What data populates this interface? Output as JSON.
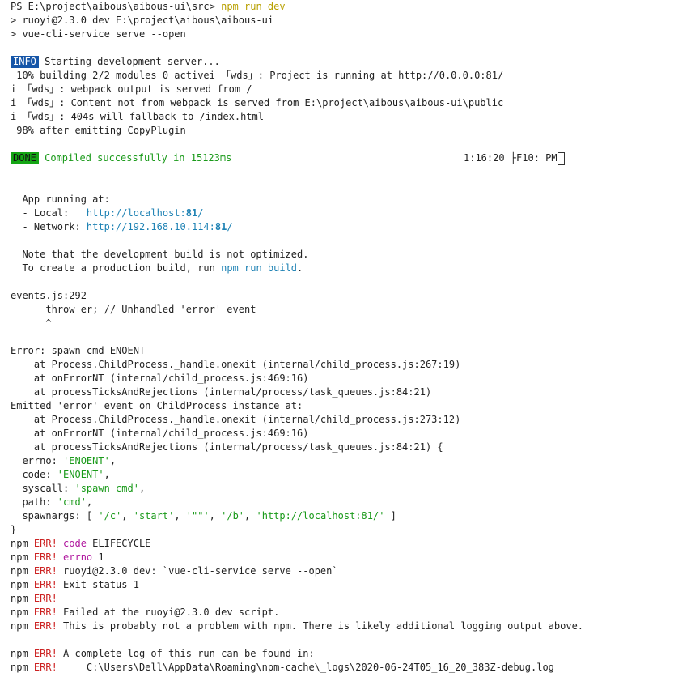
{
  "terminal": {
    "l1": {
      "prompt": "PS E:\\project\\aibous\\aibous-ui\\src> ",
      "cmd": "npm run dev"
    },
    "l2": "> ruoyi@2.3.0 dev E:\\project\\aibous\\aibous-ui",
    "l3": "> vue-cli-service serve --open",
    "info_badge": "INFO",
    "info_text": " Starting development server...",
    "building": " 10% building 2/2 modules 0 activei 「wds」: Project is running at http://0.0.0.0:81/",
    "wds1": "i 「wds」: webpack output is served from /",
    "wds2": "i 「wds」: Content not from webpack is served from E:\\project\\aibous\\aibous-ui\\public",
    "wds3": "i 「wds」: 404s will fallback to /index.html",
    "emitting": " 98% after emitting CopyPlugin",
    "done_badge": "DONE",
    "done_text": " Compiled successfully in 15123ms",
    "done_time": "1:16:20 ├F10: PM",
    "app_running": "  App running at:",
    "local_label": "  - Local:   ",
    "local_url_a": "http://localhost:",
    "local_url_b": "81",
    "local_url_c": "/",
    "network_label": "  - Network: ",
    "network_url_a": "http://192.168.10.114:",
    "network_url_b": "81",
    "network_url_c": "/",
    "note1": "  Note that the development build is not optimized.",
    "note2_a": "  To create a production build, run ",
    "note2_b": "npm run build",
    "note2_c": ".",
    "events": "events.js:292",
    "throw": "      throw er; // Unhandled 'error' event",
    "caret": "      ^",
    "err1": "Error: spawn cmd ENOENT",
    "err2": "    at Process.ChildProcess._handle.onexit (internal/child_process.js:267:19)",
    "err3": "    at onErrorNT (internal/child_process.js:469:16)",
    "err4": "    at processTicksAndRejections (internal/process/task_queues.js:84:21)",
    "emitted": "Emitted 'error' event on ChildProcess instance at:",
    "em2": "    at Process.ChildProcess._handle.onexit (internal/child_process.js:273:12)",
    "em3": "    at onErrorNT (internal/child_process.js:469:16)",
    "em4": "    at processTicksAndRejections (internal/process/task_queues.js:84:21) {",
    "errno_k": "  errno: ",
    "errno_v": "'ENOENT'",
    "comma": ",",
    "code_k": "  code: ",
    "code_v": "'ENOENT'",
    "syscall_k": "  syscall: ",
    "syscall_v": "'spawn cmd'",
    "path_k": "  path: ",
    "path_v": "'cmd'",
    "spawn_k": "  spawnargs: [ ",
    "spawn_v1": "'/c'",
    "spawn_v2": "'start'",
    "spawn_v3": "'\"\"'",
    "spawn_v4": "'/b'",
    "spawn_v5": "'http://localhost:81/'",
    "sep": ", ",
    "spawn_end": " ]",
    "close": "}",
    "npm": "npm ",
    "err": "ERR!",
    "n1_k": " code",
    "n1_v": " ELIFECYCLE",
    "n2_k": " errno",
    "n2_v": " 1",
    "n3": " ruoyi@2.3.0 dev: `vue-cli-service serve --open`",
    "n4": " Exit status 1",
    "n6": " Failed at the ruoyi@2.3.0 dev script.",
    "n7": " This is probably not a problem with npm. There is likely additional logging output above.",
    "n8": " A complete log of this run can be found in:",
    "n9": "     C:\\Users\\Dell\\AppData\\Roaming\\npm-cache\\_logs\\2020-06-24T05_16_20_383Z-debug.log"
  }
}
